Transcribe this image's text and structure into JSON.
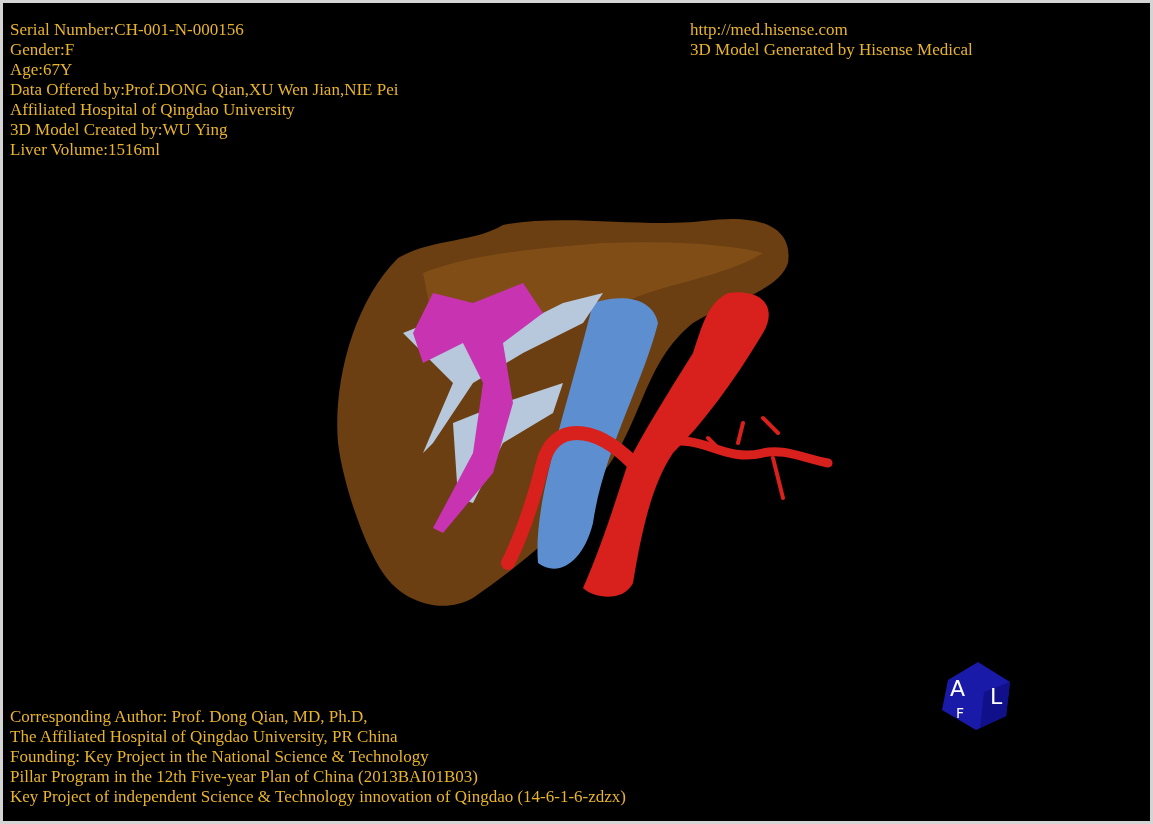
{
  "patient_info": [
    "Serial Number:CH-001-N-000156",
    "Gender:F",
    "Age:67Y",
    "Data Offered by:Prof.DONG Qian,XU Wen Jian,NIE Pei",
    "Affiliated Hospital of Qingdao University",
    "3D Model Created by:WU Ying",
    "Liver Volume:1516ml"
  ],
  "vendor_info": [
    "http://med.hisense.com",
    "3D Model Generated by Hisense Medical"
  ],
  "credits": [
    "Corresponding Author: Prof. Dong Qian, MD, Ph.D,",
    "The Affiliated Hospital of Qingdao University, PR China",
    "Founding: Key Project in the National Science & Technology",
    "Pillar Program in the 12th Five-year Plan of China (2013BAI01B03)",
    "Key Project of independent Science & Technology innovation of Qingdao (14-6-1-6-zdzx)"
  ],
  "orientation_cube": {
    "labels": [
      "A",
      "L",
      "F"
    ]
  }
}
